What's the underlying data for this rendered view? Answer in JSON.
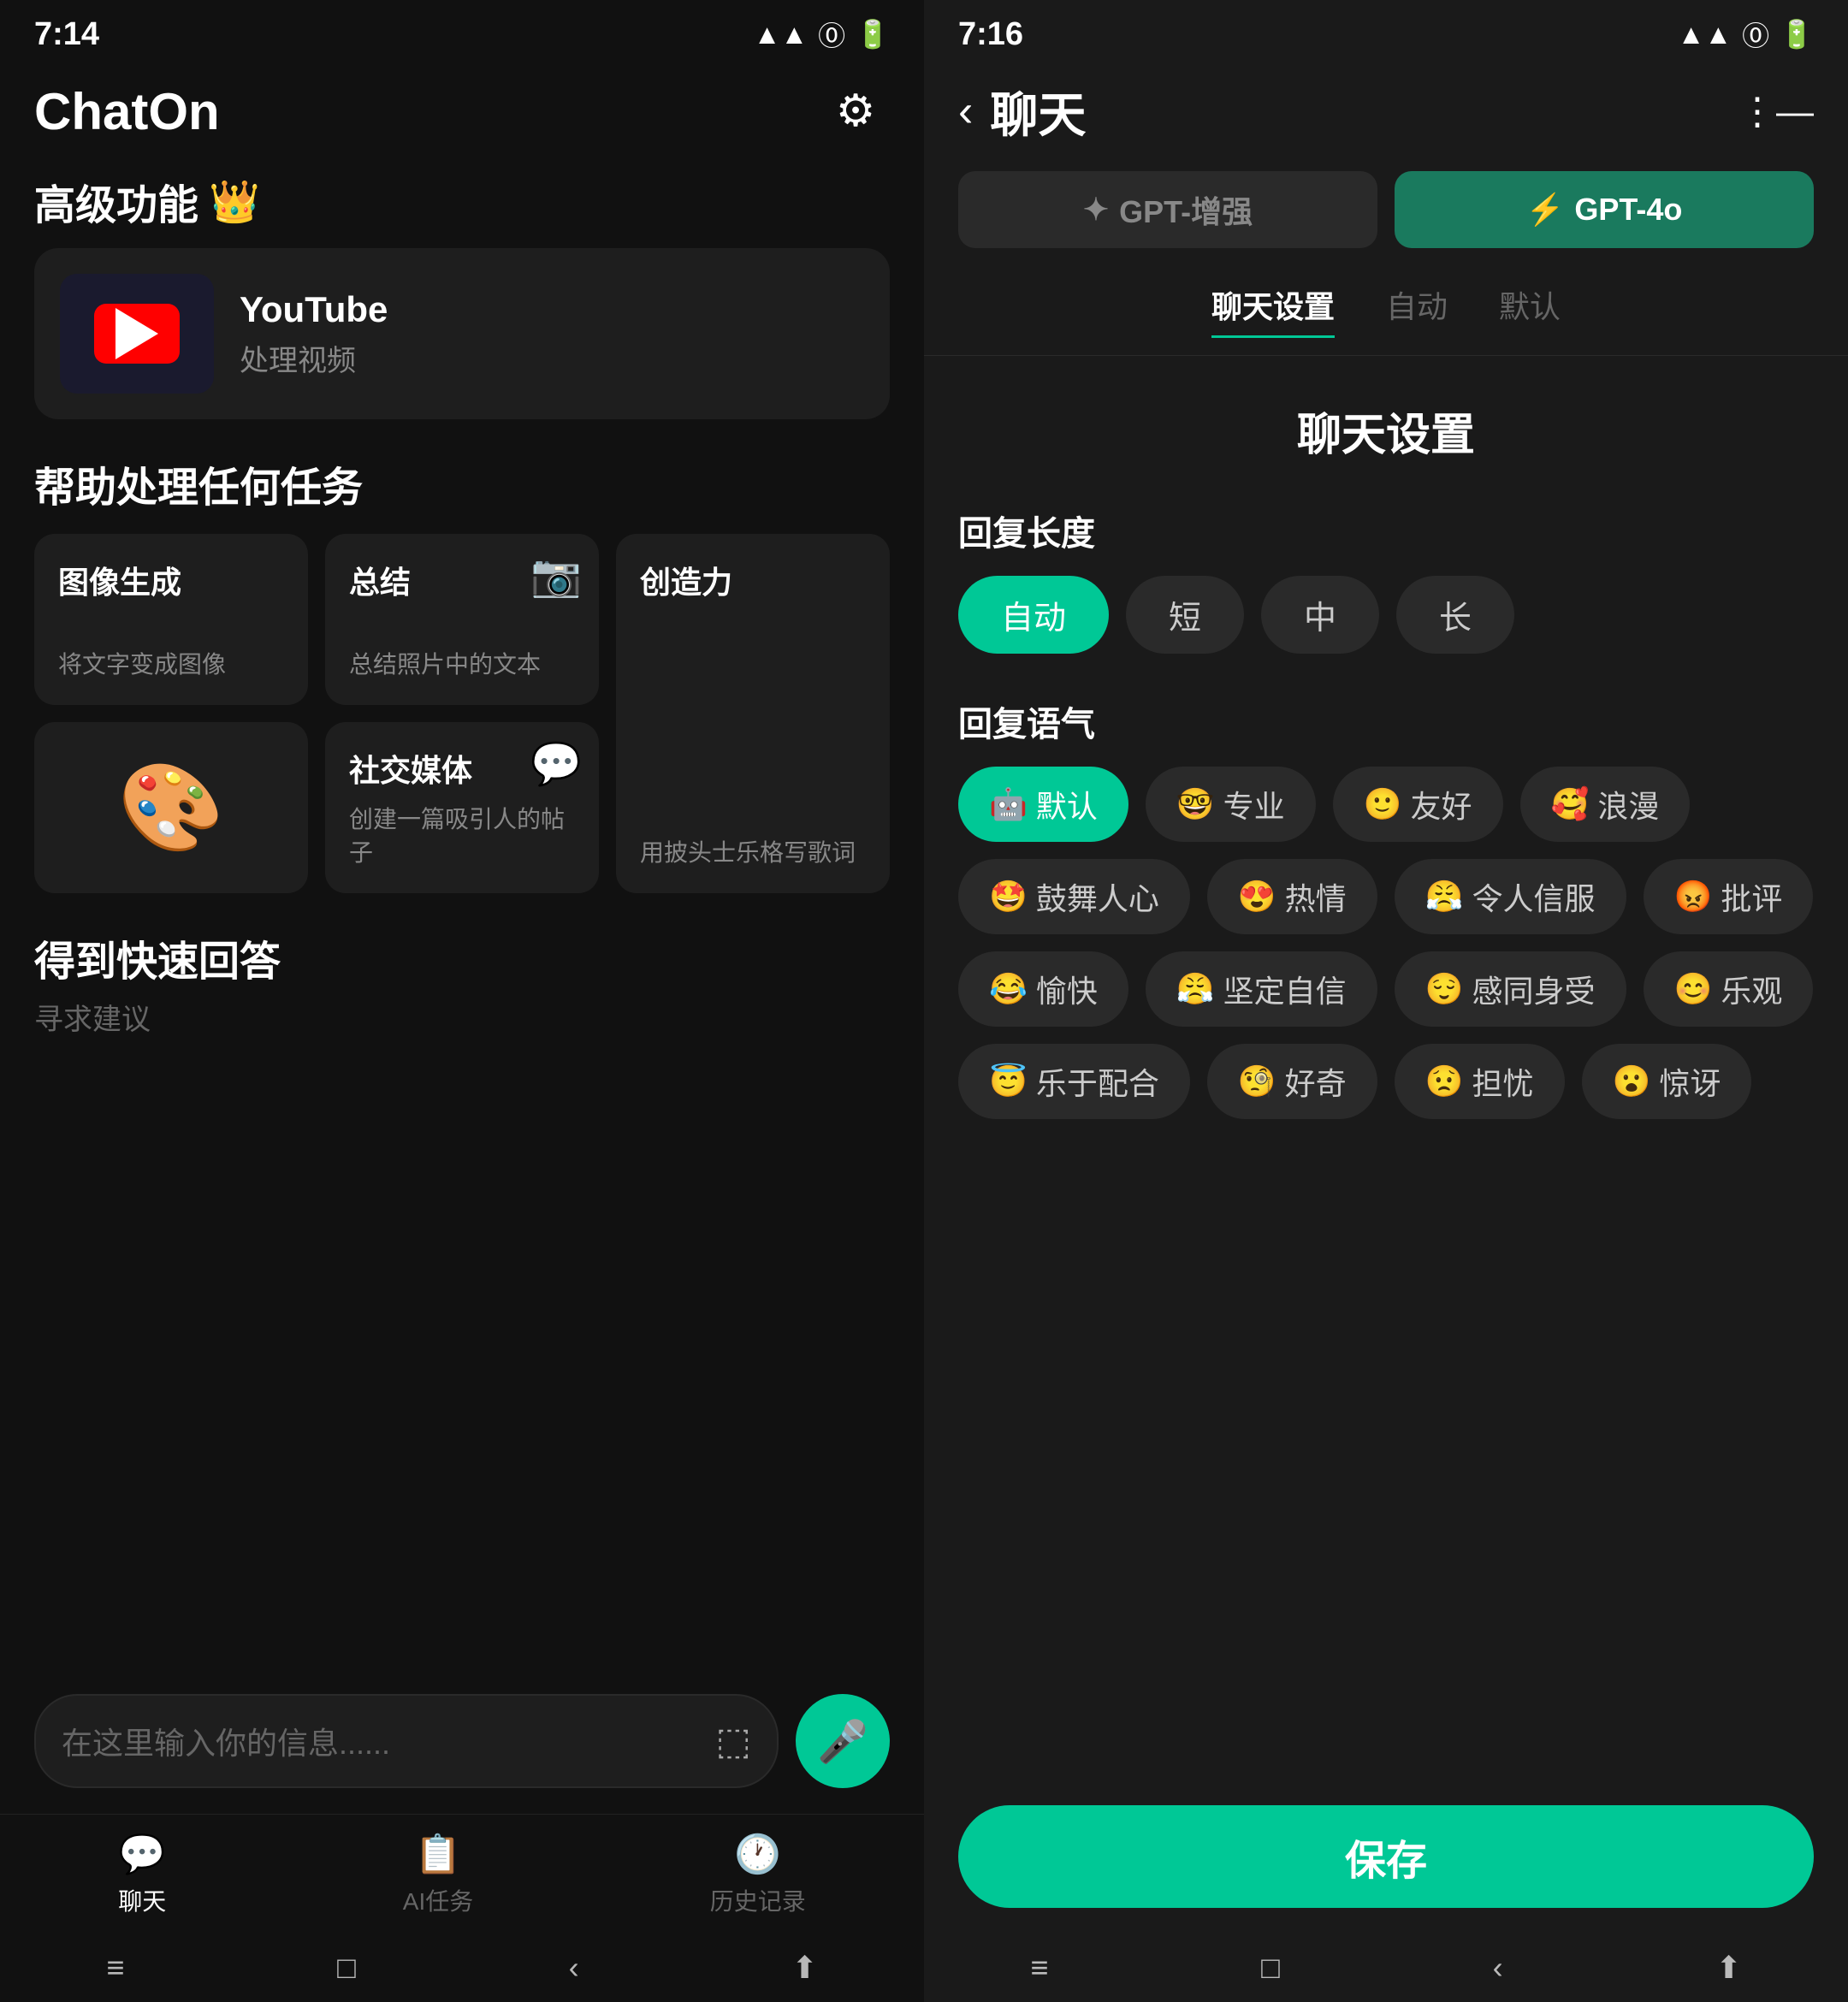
{
  "left": {
    "statusBar": {
      "time": "7:14",
      "icons": "HD ▲▲ ▲▲ ⓦ 100"
    },
    "appTitle": "ChatOn",
    "sections": {
      "premium": {
        "label": "高级功能",
        "emoji": "👑",
        "youtube": {
          "name": "YouTube",
          "desc": "处理视频"
        }
      },
      "tasks": {
        "label": "帮助处理任何任务",
        "items": [
          {
            "name": "图像生成",
            "desc": "将文字变成图像",
            "icon": ""
          },
          {
            "name": "总结",
            "desc": "总结照片中的文本",
            "icon": "📷"
          },
          {
            "name": "创造力",
            "desc": "用披头士乐格写歌词",
            "icon": ""
          },
          {
            "name": "社交媒体",
            "desc": "创建一篇吸引人的帖子",
            "icon": "💬"
          }
        ]
      },
      "quickAnswer": {
        "label": "得到快速回答",
        "sub": "寻求建议"
      }
    },
    "inputPlaceholder": "在这里输入你的信息......",
    "bottomNav": [
      {
        "icon": "💬",
        "label": "聊天",
        "active": true
      },
      {
        "icon": "📋",
        "label": "AI任务",
        "active": false
      },
      {
        "icon": "🕐",
        "label": "历史记录",
        "active": false
      }
    ],
    "sysNav": [
      "≡",
      "□",
      "<",
      "⬆"
    ]
  },
  "right": {
    "statusBar": {
      "time": "7:16",
      "icons": "HD ▲▲ ▲▲ ⓦ 100"
    },
    "header": {
      "back": "<",
      "title": "聊天",
      "menu": "⋮"
    },
    "gptTabs": [
      {
        "label": "GPT-增强",
        "icon": "✦",
        "active": false
      },
      {
        "label": "GPT-4o",
        "icon": "⚡",
        "active": true
      }
    ],
    "subTabs": [
      {
        "label": "聊天设置",
        "active": true
      },
      {
        "label": "自动",
        "active": false
      },
      {
        "label": "默认",
        "active": false
      }
    ],
    "settingsTitle": "聊天设置",
    "replyLength": {
      "label": "回复长度",
      "options": [
        {
          "label": "自动",
          "active": true
        },
        {
          "label": "短",
          "active": false
        },
        {
          "label": "中",
          "active": false
        },
        {
          "label": "长",
          "active": false
        }
      ]
    },
    "replyTone": {
      "label": "回复语气",
      "options": [
        {
          "label": "默认",
          "emoji": "🤖",
          "active": true
        },
        {
          "label": "专业",
          "emoji": "🤓",
          "active": false
        },
        {
          "label": "友好",
          "emoji": "🙂",
          "active": false
        },
        {
          "label": "浪漫",
          "emoji": "🥰",
          "active": false
        },
        {
          "label": "鼓舞人心",
          "emoji": "🤩",
          "active": false
        },
        {
          "label": "热情",
          "emoji": "😍",
          "active": false
        },
        {
          "label": "令人信服",
          "emoji": "😤",
          "active": false
        },
        {
          "label": "批评",
          "emoji": "😡",
          "active": false
        },
        {
          "label": "愉快",
          "emoji": "😂",
          "active": false
        },
        {
          "label": "坚定自信",
          "emoji": "😤",
          "active": false
        },
        {
          "label": "感同身受",
          "emoji": "😌",
          "active": false
        },
        {
          "label": "乐观",
          "emoji": "😊",
          "active": false
        },
        {
          "label": "乐于配合",
          "emoji": "😇",
          "active": false
        },
        {
          "label": "好奇",
          "emoji": "🧐",
          "active": false
        },
        {
          "label": "担忧",
          "emoji": "😟",
          "active": false
        },
        {
          "label": "惊讶",
          "emoji": "😮",
          "active": false
        }
      ]
    },
    "saveBtn": "保存",
    "sysNav": [
      "≡",
      "□",
      "<",
      "⬆"
    ]
  }
}
